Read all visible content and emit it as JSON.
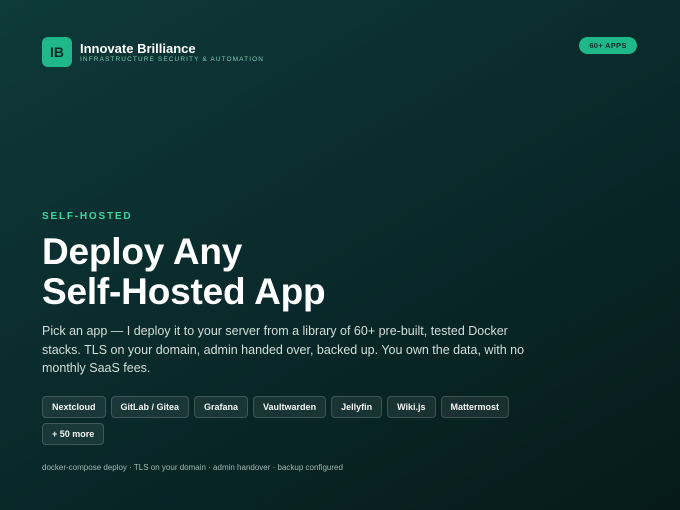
{
  "brand": {
    "logo_text": "IB",
    "name": "Innovate Brilliance",
    "tagline": "INFRASTRUCTURE SECURITY & AUTOMATION"
  },
  "badge": {
    "label": "60+ APPS"
  },
  "hero": {
    "eyebrow": "SELF-HOSTED",
    "headline_line1": "Deploy Any",
    "headline_line2": "Self-Hosted App",
    "description": "Pick an app — I deploy it to your server from a library of 60+ pre-built, tested Docker stacks. TLS on your domain, admin handed over, backed up. You own the data, with no monthly SaaS fees."
  },
  "apps": [
    {
      "label": "Nextcloud"
    },
    {
      "label": "GitLab / Gitea"
    },
    {
      "label": "Grafana"
    },
    {
      "label": "Vaultwarden"
    },
    {
      "label": "Jellyfin"
    },
    {
      "label": "Wiki.js"
    },
    {
      "label": "Mattermost"
    },
    {
      "label": "+ 50 more"
    }
  ],
  "footnote": "docker-compose deploy · TLS on your domain · admin handover · backup configured",
  "colors": {
    "accent": "#1eb88a",
    "eyebrow": "#3fd6a2",
    "background_top": "#0f3a3a",
    "background_bottom": "#061a1b"
  }
}
